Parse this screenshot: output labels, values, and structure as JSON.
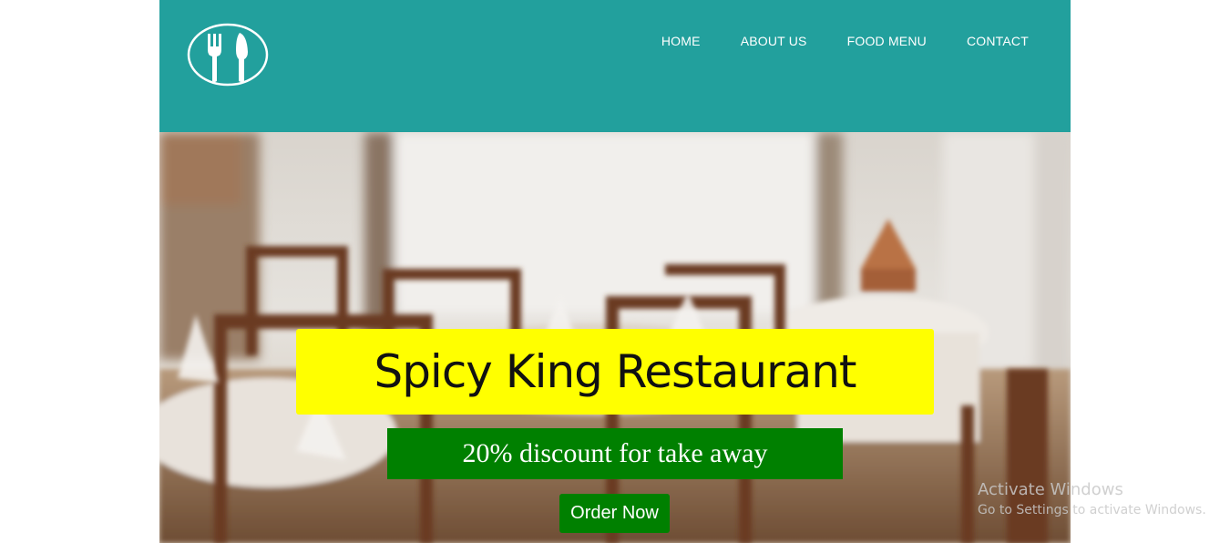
{
  "header": {
    "logo_icon": "fork-knife-icon",
    "background_color": "#22a09d"
  },
  "nav": {
    "items": [
      {
        "label": "HOME"
      },
      {
        "label": "ABOUT US"
      },
      {
        "label": "FOOD MENU"
      },
      {
        "label": "CONTACT"
      }
    ]
  },
  "hero": {
    "background_image": "blurred-restaurant-dining-room",
    "title": "Spicy King Restaurant",
    "title_bg_color": "#ffff00",
    "subtitle": "20% discount for take away",
    "subtitle_bg_color": "#008000",
    "cta_label": "Order Now",
    "cta_bg_color": "#008000"
  },
  "watermark": {
    "title": "Activate Windows",
    "subtitle": "Go to Settings to activate Windows."
  }
}
